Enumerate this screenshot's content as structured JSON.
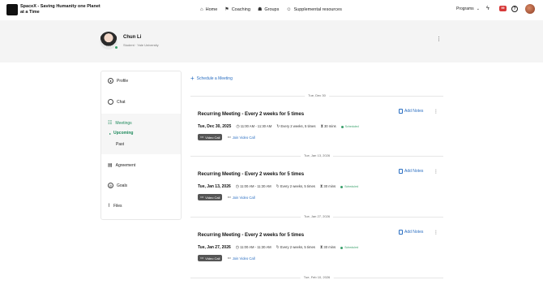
{
  "topnav": {
    "org_name": "SpaceX - Saving Humanity one Planet at a Time",
    "links": [
      {
        "label": "Home",
        "icon": "home-icon"
      },
      {
        "label": "Coaching",
        "icon": "coaching-icon"
      },
      {
        "label": "Groups",
        "icon": "groups-icon"
      },
      {
        "label": "Supplemental resources",
        "icon": "resources-icon"
      }
    ],
    "programs_label": "Programs",
    "notification_badge": "99",
    "help_label": "?"
  },
  "profile": {
    "name": "Chun Li",
    "subtitle": "Student · Yale University"
  },
  "sidebar": {
    "items": [
      {
        "label": "Profile",
        "icon": "profile-icon"
      },
      {
        "label": "Chat",
        "icon": "chat-icon"
      },
      {
        "label": "Meetings",
        "icon": "meetings-icon"
      },
      {
        "label": "Agreement",
        "icon": "agreement-icon"
      },
      {
        "label": "Goals",
        "icon": "goals-icon"
      },
      {
        "label": "Files",
        "icon": "files-icon"
      }
    ],
    "meeting_subitems": [
      {
        "label": "Upcoming"
      },
      {
        "label": "Past"
      }
    ]
  },
  "main": {
    "schedule_label": "Schedule a Meeting",
    "add_notes_label": "Add Notes",
    "video_call_tag": "Video Call",
    "join_label": "Join Video Call",
    "meetings": [
      {
        "divider": "Tue, Dec 30",
        "title": "Recurring Meeting - Every 2 weeks for 5 times",
        "date": "Tue, Dec 30, 2025",
        "time": "11:00 AM - 11:30 AM",
        "recurrence": "Every 2 weeks, 5 times",
        "duration": "30 mins",
        "status": "Scheduled"
      },
      {
        "divider": "Tue, Jan 13, 2026",
        "title": "Recurring Meeting - Every 2 weeks for 5 times",
        "date": "Tue, Jan 13, 2026",
        "time": "11:00 AM - 11:30 AM",
        "recurrence": "Every 2 weeks, 5 times",
        "duration": "30 mins",
        "status": "Scheduled"
      },
      {
        "divider": "Tue, Jan 27, 2026",
        "title": "Recurring Meeting - Every 2 weeks for 5 times",
        "date": "Tue, Jan 27, 2026",
        "time": "11:00 AM - 11:30 AM",
        "recurrence": "Every 2 weeks, 5 times",
        "duration": "30 mins",
        "status": "Scheduled"
      },
      {
        "divider": "Tue, Feb 10, 2026"
      }
    ]
  },
  "colors": {
    "accent_blue": "#2b6fc2",
    "accent_green": "#1f8a5c",
    "status_green": "#3aa06b",
    "badge_red": "#d63939"
  }
}
